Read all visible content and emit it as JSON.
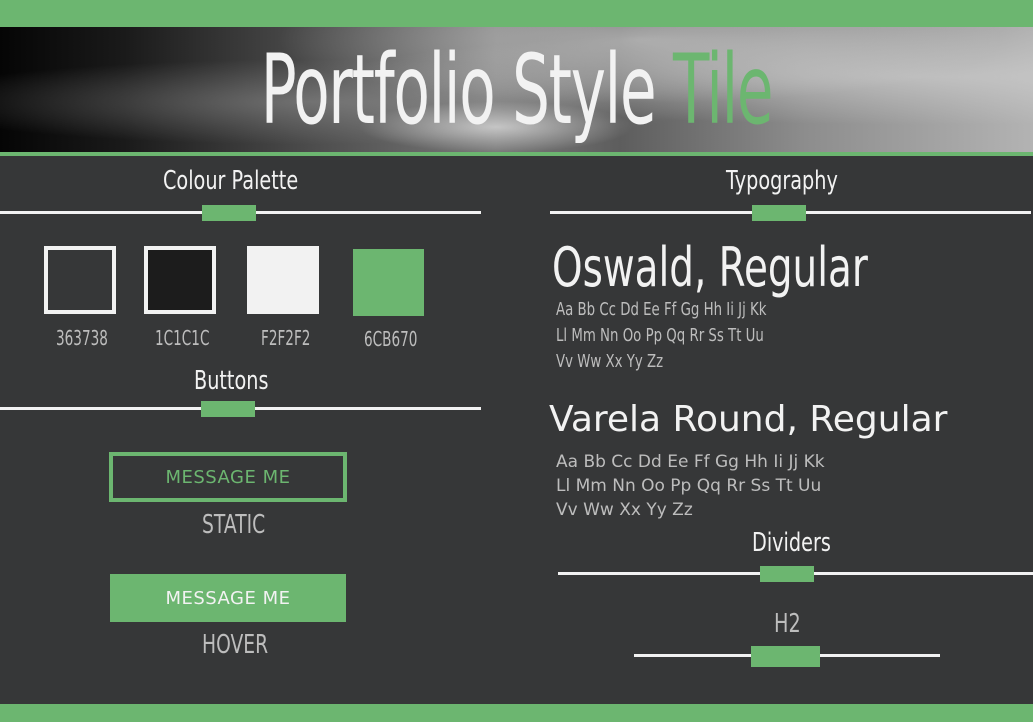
{
  "header": {
    "title_part1": "Portfolio Style",
    "title_part2": "Tile"
  },
  "colour_palette": {
    "heading": "Colour Palette",
    "swatches": [
      {
        "hex": "#363738",
        "code": "363738"
      },
      {
        "hex": "#1C1C1C",
        "code": "1C1C1C"
      },
      {
        "hex": "#F2F2F2",
        "code": "F2F2F2"
      },
      {
        "hex": "#6CB670",
        "code": "6CB670"
      }
    ]
  },
  "buttons": {
    "heading": "Buttons",
    "static": {
      "label": "MESSAGE ME",
      "state": "STATIC"
    },
    "hover": {
      "label": "MESSAGE ME",
      "state": "HOVER"
    }
  },
  "typography": {
    "heading": "Typography",
    "fonts": [
      {
        "name": "Oswald, Regular",
        "alphabet": [
          "Aa Bb Cc Dd Ee Ff Gg Hh Ii Jj Kk",
          "Ll Mm Nn Oo Pp Qq Rr Ss Tt Uu",
          "Vv Ww Xx Yy Zz"
        ]
      },
      {
        "name": "Varela Round, Regular",
        "alphabet": [
          "Aa Bb Cc Dd Ee Ff Gg Hh Ii Jj Kk",
          "Ll Mm Nn Oo Pp Qq Rr Ss Tt Uu",
          "Vv Ww Xx Yy Zz"
        ]
      }
    ]
  },
  "dividers": {
    "heading": "Dividers",
    "h2_label": "H2"
  },
  "colors": {
    "background": "#363738",
    "accent": "#6CB670",
    "text": "#F2F2F2",
    "muted_text": "#BDBDBD"
  }
}
